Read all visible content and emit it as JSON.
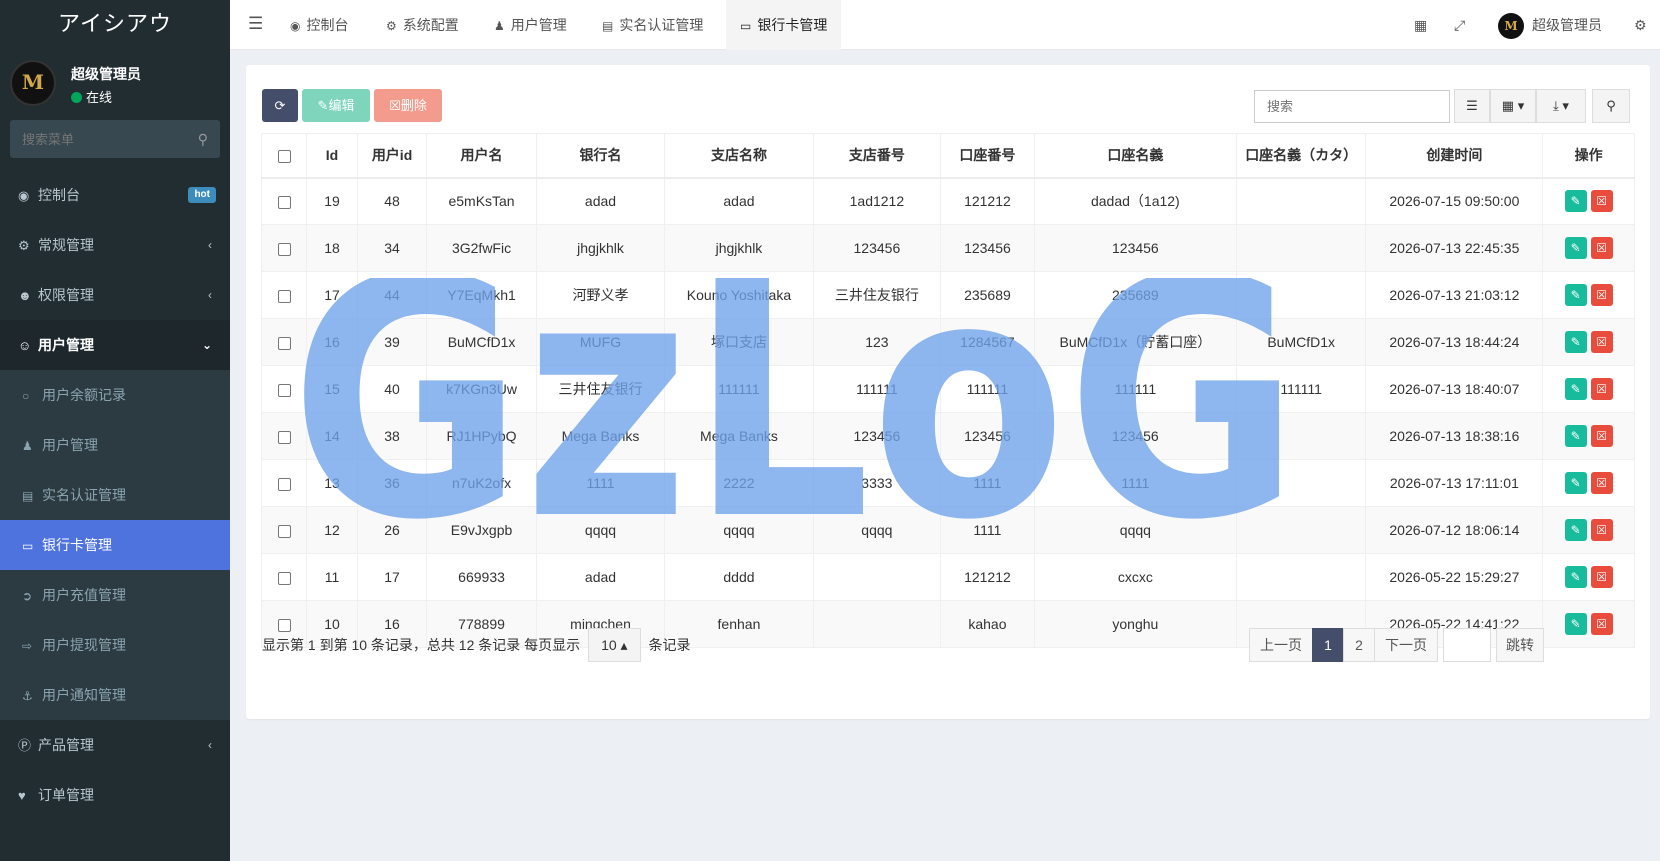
{
  "sidebar": {
    "logo": "アイシアウ",
    "avatar_text": "M",
    "user_name": "超级管理员",
    "status": "在线",
    "search_placeholder": "搜索菜单",
    "items": [
      {
        "label": "控制台",
        "icon": "dashboard-icon",
        "badge": "hot"
      },
      {
        "label": "常规管理",
        "icon": "cogs-icon"
      },
      {
        "label": "权限管理",
        "icon": "group-icon"
      },
      {
        "label": "用户管理",
        "icon": "user-circle-icon"
      }
    ],
    "subitems": [
      {
        "label": "用户余额记录",
        "icon": "circle-o-icon"
      },
      {
        "label": "用户管理",
        "icon": "user-icon"
      },
      {
        "label": "实名认证管理",
        "icon": "id-card-icon"
      },
      {
        "label": "银行卡管理",
        "icon": "credit-card-icon"
      },
      {
        "label": "用户充值管理",
        "icon": "sign-in-icon"
      },
      {
        "label": "用户提现管理",
        "icon": "sign-out-icon"
      },
      {
        "label": "用户通知管理",
        "icon": "anchor-icon"
      }
    ],
    "bottom_items": [
      {
        "label": "产品管理",
        "icon": "product-icon"
      },
      {
        "label": "订单管理",
        "icon": "heartbeat-icon"
      }
    ]
  },
  "header": {
    "tabs": [
      "控制台",
      "系统配置",
      "用户管理",
      "实名认证管理",
      "银行卡管理"
    ],
    "user": "超级管理员"
  },
  "toolbar": {
    "edit_label": "编辑",
    "delete_label": "删除",
    "search_placeholder": "搜索"
  },
  "table": {
    "columns": [
      "Id",
      "用户id",
      "用户名",
      "银行名",
      "支店名称",
      "支店番号",
      "口座番号",
      "口座名義",
      "口座名義（カタ）",
      "创建时间",
      "操作"
    ],
    "rows": [
      [
        "19",
        "48",
        "e5mKsTan",
        "adad",
        "adad",
        "1ad1212",
        "121212",
        "dadad（1a12)",
        "",
        "2026-07-15 09:50:00"
      ],
      [
        "18",
        "34",
        "3G2fwFic",
        "jhgjkhlk",
        "jhgjkhlk",
        "123456",
        "123456",
        "123456",
        "",
        "2026-07-13 22:45:35"
      ],
      [
        "17",
        "44",
        "Y7EqMkh1",
        "河野义孝",
        "Kouno Yoshitaka",
        "三井住友银行",
        "235689",
        "235689",
        "",
        "2026-07-13 21:03:12"
      ],
      [
        "16",
        "39",
        "BuMCfD1x",
        "MUFG",
        "塚口支店",
        "123",
        "1284567",
        "BuMCfD1x（貯蓄口座）",
        "BuMCfD1x",
        "2026-07-13 18:44:24"
      ],
      [
        "15",
        "40",
        "k7KGn3Uw",
        "三井住友银行",
        "111111",
        "111111",
        "111111",
        "111111",
        "111111",
        "2026-07-13 18:40:07"
      ],
      [
        "14",
        "38",
        "RJ1HPybQ",
        "Mega Banks",
        "Mega Banks",
        "123456",
        "123456",
        "123456",
        "",
        "2026-07-13 18:38:16"
      ],
      [
        "13",
        "36",
        "n7uK2ofx",
        "1111",
        "2222",
        "3333",
        "1111",
        "1111",
        "",
        "2026-07-13 17:11:01"
      ],
      [
        "12",
        "26",
        "E9vJxgpb",
        "qqqq",
        "qqqq",
        "qqqq",
        "1111",
        "qqqq",
        "",
        "2026-07-12 18:06:14"
      ],
      [
        "11",
        "17",
        "669933",
        "adad",
        "dddd",
        "",
        "121212",
        "cxcxc",
        "",
        "2026-05-22 15:29:27"
      ],
      [
        "10",
        "16",
        "778899",
        "mingchen",
        "fenhan",
        "",
        "kahao",
        "yonghu",
        "",
        "2026-05-22 14:41:22"
      ]
    ]
  },
  "footer": {
    "info_prefix": "显示第 1 到第 10 条记录，总共 12 条记录 每页显示",
    "page_size": "10",
    "info_suffix": "条记录",
    "prev": "上一页",
    "pages": [
      "1",
      "2"
    ],
    "next": "下一页",
    "jump": "跳转"
  },
  "watermark": "GzLoG",
  "colors": {
    "sidebar_bg": "#222d32",
    "active_menu": "#4e73df",
    "edit_green": "#18bc9c",
    "delete_red": "#e74c3c",
    "watermark_blue": "#6ea2ea"
  }
}
